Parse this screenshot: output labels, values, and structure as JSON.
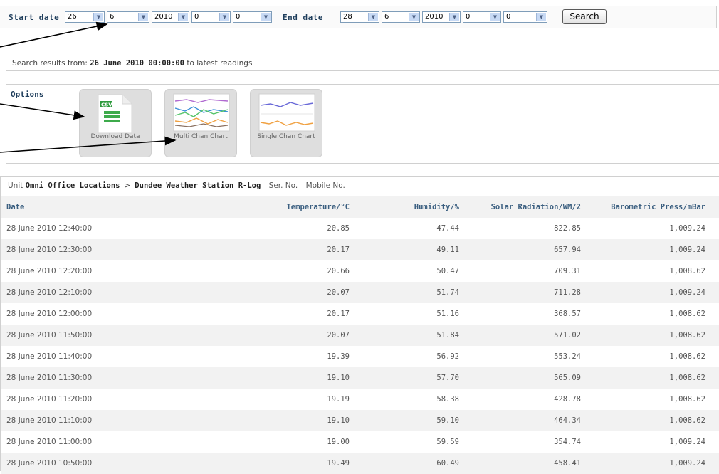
{
  "filter": {
    "start_label": "Start date",
    "start": {
      "day": "26",
      "month": "6",
      "year": "2010",
      "hour": "0",
      "minute": "0"
    },
    "end_label": "End date",
    "end": {
      "day": "28",
      "month": "6",
      "year": "2010",
      "hour": "0",
      "minute": "0"
    },
    "search_label": "Search"
  },
  "results": {
    "prefix": "Search results from: ",
    "from": "26 June 2010 00:00:00",
    "suffix": " to latest readings"
  },
  "options": {
    "title": "Options",
    "items": [
      {
        "label": "Download Data",
        "icon": "csv-file-icon"
      },
      {
        "label": "Multi Chan Chart",
        "icon": "multi-line-chart-icon"
      },
      {
        "label": "Single Chan Chart",
        "icon": "single-line-chart-icon"
      }
    ]
  },
  "table": {
    "breadcrumb": {
      "unit_label": "Unit",
      "site": "Omni Office Locations",
      "separator": ">",
      "station": "Dundee Weather Station R-Log",
      "serial": "Ser. No.",
      "mobile": "Mobile No."
    },
    "columns": [
      "Date",
      "Temperature/°C",
      "Humidity/%",
      "Solar Radiation/WM/2",
      "Barometric Press/mBar"
    ],
    "rows": [
      [
        "28 June 2010 12:40:00",
        "20.85",
        "47.44",
        "822.85",
        "1,009.24"
      ],
      [
        "28 June 2010 12:30:00",
        "20.17",
        "49.11",
        "657.94",
        "1,009.24"
      ],
      [
        "28 June 2010 12:20:00",
        "20.66",
        "50.47",
        "709.31",
        "1,008.62"
      ],
      [
        "28 June 2010 12:10:00",
        "20.07",
        "51.74",
        "711.28",
        "1,009.24"
      ],
      [
        "28 June 2010 12:00:00",
        "20.17",
        "51.16",
        "368.57",
        "1,008.62"
      ],
      [
        "28 June 2010 11:50:00",
        "20.07",
        "51.84",
        "571.02",
        "1,008.62"
      ],
      [
        "28 June 2010 11:40:00",
        "19.39",
        "56.92",
        "553.24",
        "1,008.62"
      ],
      [
        "28 June 2010 11:30:00",
        "19.10",
        "57.70",
        "565.09",
        "1,008.62"
      ],
      [
        "28 June 2010 11:20:00",
        "19.19",
        "58.38",
        "428.78",
        "1,008.62"
      ],
      [
        "28 June 2010 11:10:00",
        "19.10",
        "59.10",
        "464.34",
        "1,008.62"
      ],
      [
        "28 June 2010 11:00:00",
        "19.00",
        "59.59",
        "354.74",
        "1,009.24"
      ],
      [
        "28 June 2010 10:50:00",
        "19.49",
        "60.49",
        "458.41",
        "1,009.24"
      ]
    ]
  }
}
